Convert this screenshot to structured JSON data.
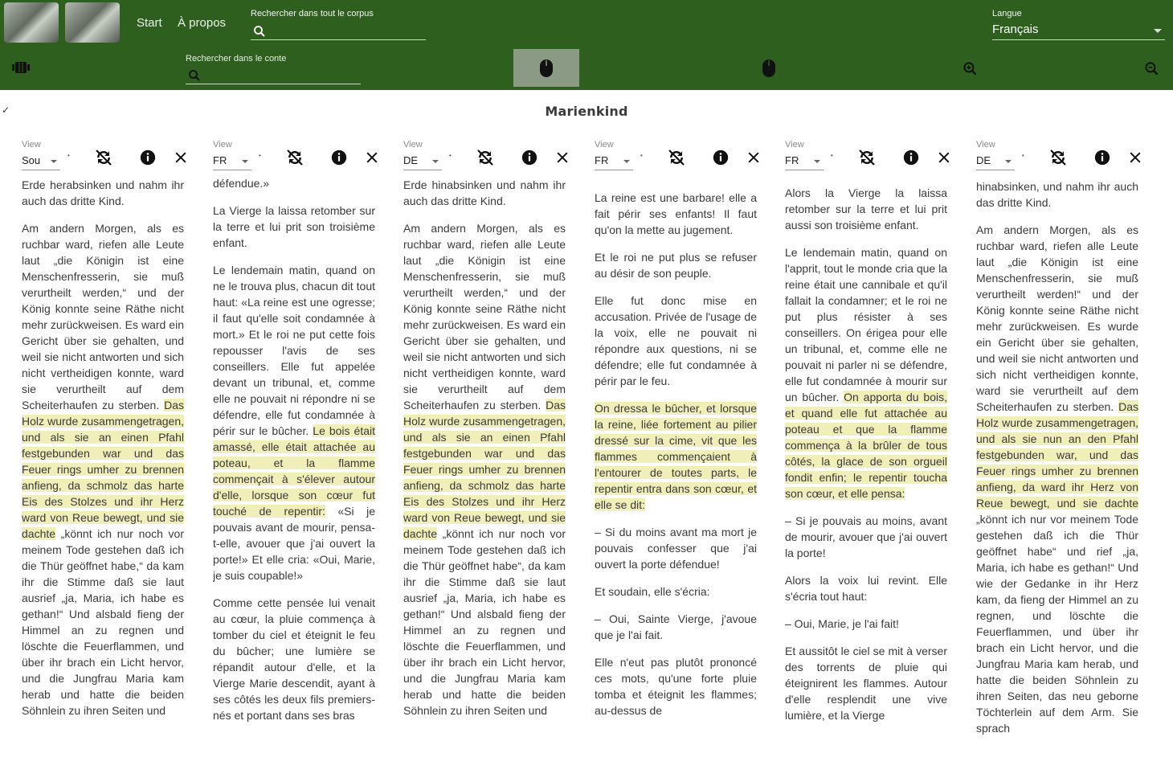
{
  "header": {
    "nav": [
      "Start",
      "À propos"
    ],
    "global_search": {
      "label": "Rechercher dans tout le corpus",
      "value": ""
    },
    "language": {
      "label": "Langue",
      "value": "Français"
    }
  },
  "toolbar": {
    "search": {
      "label": "Rechercher dans le conte",
      "value": ""
    }
  },
  "check_mark": "✓",
  "title": "Marienkind",
  "columns": [
    {
      "view_label": "View",
      "view_value": "Sou",
      "text_html": "<p>Erde herabsinken und nahm ihr auch das dritte Kind.</p><p>Am andern Morgen, als es ruchbar ward, riefen alle Leute laut „die Königin ist eine Menschenfresserin, sie muß verurtheilt werden,“ und der König konnte seine Räthe nicht mehr zurückweisen. Es ward ein Gericht über sie gehalten, und weil sie nicht antworten und sich nicht vertheidigen konnte, ward sie verurtheilt auf dem Scheiterhaufen zu sterben. <mark>Das Holz wurde zusammengetragen, und als sie an einen Pfahl festgebunden war und das Feuer rings umher zu brennen anfieng, da schmolz das harte Eis des Stolzes und ihr Herz ward von Reue bewegt, und sie dachte</mark> „könnt ich nur noch vor meinem Tode gestehen daß ich die Thür geöffnet habe,“ da kam ihr die Stimme daß sie laut ausrief „ja, Maria, ich habe es gethan!“ Und alsbald fieng der Himmel an zu regnen und löschte die Feuerflammen, und über ihr brach ein Licht hervor, und die Jungfrau Maria kam herab und hatte die beiden Söhnlein zu ihren Seiten und</p>"
    },
    {
      "view_label": "View",
      "view_value": "FR",
      "text_html": "<p>défendue.»</p><p>La Vierge la laissa retomber sur la terre et lui prit son troisième enfant.</p><p>Le lendemain matin, quand on ne le trouva plus, chacun dit tout haut: «La reine est une ogresse; il faut qu'elle soit condamnée à mort.» Et le roi ne put cette fois repousser l'avis de ses conseillers. Elle fut appelée devant un tribunal, et, comme elle ne pouvait ni répondre ni se défendre, elle fut condamnée à périr sur le bûcher. <mark>Le bois était amassé, elle était attachée au poteau, et la flamme commençait à s'élever autour d'elle, lorsque son cœur fut touché de repentir:</mark> «Si je pouvais avant de mourir, pensa-t-elle, avouer que j'ai ouvert la porte!» Et elle cria: «Oui, Marie, je suis coupable!»</p><p>Comme cette pensée lui venait au cœur, la pluie commença à tomber du ciel et éteignit le feu du bûcher; une lumière se répandit autour d'elle, et la Vierge Marie descendit, ayant à ses côtés les deux fils premiers-nés et portant dans ses bras</p>"
    },
    {
      "view_label": "View",
      "view_value": "DE",
      "text_html": "<p>Erde hinabsinken und nahm ihr auch das dritte Kind.</p><p>Am andern Morgen, als es ruchbar ward, riefen alle Leute laut „die Königin ist eine Menschenfresserin, sie muß verurtheilt werden,“ und der König konnte seine Räthe nicht mehr zurückweisen. Es ward ein Gericht über sie gehalten, und weil sie nicht antworten und sich nicht vertheidigen konnte, ward sie verurtheilt auf dem Scheiterhaufen zu sterben. <mark>Das Holz wurde zusammengetragen, und als sie an einen Pfahl festgebunden war und das Feuer rings umher zu brennen anfieng, da schmolz das harte Eis des Stolzes und ihr Herz ward von Reue bewegt, und sie dachte</mark> „könnt ich nur noch vor meinem Tode gestehen daß ich die Thür geöffnet habe“, da kam ihr die Stimme daß sie laut ausrief „ja, Maria, ich habe es gethan!“ Und alsbald fieng der Himmel an zu regnen und löschte die Feuerflammen, und über ihr brach ein Licht hervor, und die Jungfrau Maria kam herab und hatte die beiden Söhnlein zu ihren Seiten und</p>"
    },
    {
      "view_label": "View",
      "view_value": "FR",
      "text_html": "<p>d'une voix unanime:</p><p>La reine est une barbare! elle a fait périr ses enfants! Il faut qu'on la mette au jugement.</p><p>Et le roi ne put plus se refuser au désir de son peuple.</p><p>Elle fut donc mise en accusation. Privée de l'usage de la voix, elle ne pouvait ni répondre aux questions, ni se défendre; elle fut condamnée à périr par le feu.</p><p><mark>On dressa le bûcher, et lorsque la reine, liée fortement au pilier dressé sur la cime, vit que les flammes commençaient à l'entourer de toutes parts, le repentir entra dans son cœur, et elle se dit:</mark></p><p>– Si du moins avant ma mort je pouvais confesser que j'ai ouvert la porte défendue!</p><p>Et soudain, elle s'écria:</p><p>– Oui, Sainte Vierge, j'avoue que je l'ai fait.</p><p>Elle n'eut pas plutôt prononcé ces mots, qu'une forte pluie tomba et éteignit les flammes; au-dessus de</p>"
    },
    {
      "view_label": "View",
      "view_value": "FR",
      "text_html": "<p>Alors la Vierge la laissa retomber sur la terre et lui prit aussi son troisième enfant.</p><p>Le lendemain matin, quand on l'apprit, tout le monde cria que la reine était une cannibale et qu'il fallait la condamner; et le roi ne put plus résister à ses conseillers. On érigea pour elle un tribunal, et, comme elle ne pouvait ni parler ni se défendre, elle fut condamnée à mourir sur un bûcher. <mark>On apporta du bois, et quand elle fut attachée au poteau et que la flamme commença à la brûler de tous côtés, la glace de son orgueil fondit enfin; le repentir toucha son cœur, et elle pensa:</mark></p><p>– Si je pouvais au moins, avant de mourir, avouer que j'ai ouvert la porte!</p><p>Alors la voix lui revint. Elle s'écria tout haut:</p><p>– Oui, Marie, je l'ai fait!</p><p>Et aussitôt le ciel se mit à verser des torrents de pluie qui éteignirent les flammes. Autour d'elle resplendit une vive lumière, et la Vierge</p>"
    },
    {
      "view_label": "View",
      "view_value": "DE",
      "text_html": "<p>sie die Jungfrau wieder zur Erde hinabsinken, und nahm ihr auch das dritte Kind.</p><p>Am andern Morgen, als es ruchbar ward, riefen alle Leute laut „die Königin ist eine Menschenfresserin, sie muß verurtheilt werden!“ und der König konnte seine Räthe nicht mehr zurückweisen. Es wurde ein Gericht über sie gehalten, und weil sie nicht antworten und sich nicht vertheidigen konnte, ward sie verurtheilt auf dem Scheiterhaufen zu sterben. <mark>Das Holz wurde zusammengetragen, und als sie nun an den Pfahl festgebunden war, und das Feuer rings umher zu brennen anfieng, da ward ihr Herz von Reue bewegt, und sie dachte</mark> „könnt ich nur vor meinem Tode gestehen daß ich die Thür geöffnet habe“ und rief „ja, Maria, ich habe es gethan!“ Und wie der Gedanke in ihr Herz kam, da fieng der Himmel an zu regnen, und löschte die Feuerflammen, und über ihr brach ein Licht hervor, und die Jungfrau Maria kam herab, und hatte die beiden Söhnlein zu ihren Seiten, das neu geborne Töchterlein auf dem Arm. Sie sprach</p>"
    }
  ]
}
